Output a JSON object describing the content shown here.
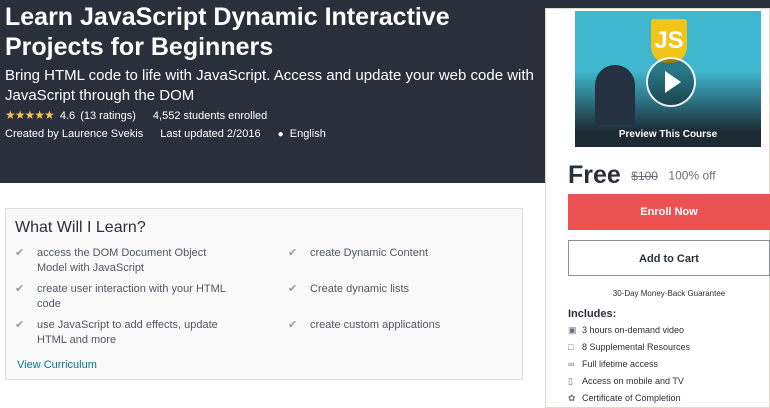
{
  "course": {
    "title": "Learn JavaScript Dynamic Interactive Projects for Beginners",
    "subtitle": "Bring HTML code to life with JavaScript. Access and update your web code with JavaScript through the DOM",
    "stars": "★★★★★",
    "rating_value": "4.6",
    "rating_count": "(13 ratings)",
    "enrolled": "4,552 students enrolled",
    "created_by": "Created by Laurence Svekis",
    "last_updated": "Last updated 2/2016",
    "language": "English"
  },
  "learn": {
    "title": "What Will I Learn?",
    "items_left": [
      "access the DOM Document Object Model with JavaScript",
      "create user interaction with your HTML code",
      "use JavaScript to add effects, update HTML and more"
    ],
    "items_right": [
      "create Dynamic Content",
      "Create dynamic lists",
      "create custom applications"
    ],
    "view_curriculum": "View Curriculum"
  },
  "sidebar": {
    "preview_logo": "JS",
    "preview_label": "Preview This Course",
    "price": "Free",
    "original_price": "$100",
    "discount": "100% off",
    "enroll_label": "Enroll Now",
    "cart_label": "Add to Cart",
    "guarantee": "30-Day Money-Back Guarantee",
    "includes_title": "Includes:",
    "includes": [
      {
        "icon": "video-icon",
        "text": "3 hours on-demand video"
      },
      {
        "icon": "file-icon",
        "text": "8 Supplemental Resources"
      },
      {
        "icon": "infinity-icon",
        "text": "Full lifetime access"
      },
      {
        "icon": "mobile-icon",
        "text": "Access on mobile and TV"
      },
      {
        "icon": "certificate-icon",
        "text": "Certificate of Completion"
      }
    ]
  },
  "colors": {
    "hero_bg": "#29303b",
    "star": "#f4c150",
    "enroll_bg": "#ec5252",
    "link": "#007791"
  }
}
